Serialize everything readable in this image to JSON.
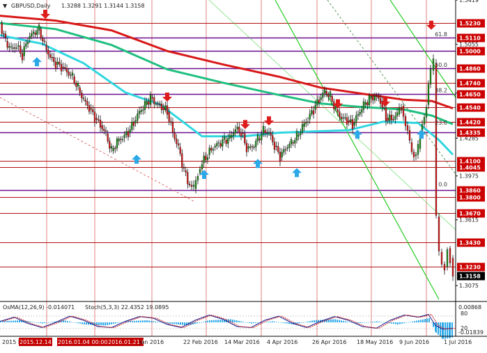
{
  "header": {
    "symbol_text": "GBPUSD,Daily",
    "ohlc_text": "1.3288 1.3291 1.3144 1.3158"
  },
  "osc": {
    "osma_text": "OsMA(12,26,9) -0.014071",
    "stoch_text": "Stoch(5,3,3) 22.4352 19.0895",
    "max_label": "0.00868",
    "min_label": "-0.01839",
    "level_80": "80",
    "level_20": "20"
  },
  "xaxis": {
    "ticks": [
      "2015 Nov",
      "2015.12.14",
      "2016.01.04 00:00",
      "2016.01.21 00:00",
      "Jan 2016",
      "22 Feb 2016",
      "14 Mar 2016",
      "4 Apr 2016",
      "26 Apr 2016",
      "18 May 2016",
      "9 Jun 2016",
      "1 Jul 2016"
    ],
    "highlight_from": 1,
    "highlight_to": 3
  },
  "colors": {
    "bull_candle": "#1a8a1a",
    "bear_candle": "#d01818",
    "ema200": "#d81818",
    "ema144": "#1fbf7f",
    "ema50": "#2fd6e0",
    "level_line": "#b01010",
    "level_line_purple": "#6a0f8e",
    "level_label_bg": "#cc0000",
    "arrow_up": "#2aa8e8",
    "arrow_down": "#dd1c1c",
    "channel": "#22cc22",
    "osma": "#2aa8e8",
    "stoch_main": "#1a1a8a",
    "stoch_signal": "#cc2222",
    "current_price_bg": "#000000"
  },
  "chart_data": {
    "type": "candlestick",
    "title": "GBPUSD,Daily",
    "ylim": [
      1.2962,
      1.5419
    ],
    "yticks": [
      1.5419,
      1.5055,
      1.4655,
      1.4285,
      1.3975,
      1.3615,
      1.3075
    ],
    "price_levels": [
      {
        "value": 1.523,
        "label": "1.5230"
      },
      {
        "value": 1.511,
        "label": "1.5110"
      },
      {
        "value": 1.5,
        "label": "1.5000"
      },
      {
        "value": 1.486,
        "label": "1.4860"
      },
      {
        "value": 1.474,
        "label": "1.4740"
      },
      {
        "value": 1.465,
        "label": "1.4650"
      },
      {
        "value": 1.454,
        "label": "1.4540"
      },
      {
        "value": 1.442,
        "label": "1.4420"
      },
      {
        "value": 1.4335,
        "label": "1.4335"
      },
      {
        "value": 1.41,
        "label": "1.4100"
      },
      {
        "value": 1.4045,
        "label": "1.4045"
      },
      {
        "value": 1.386,
        "label": "1.3860"
      },
      {
        "value": 1.38,
        "label": "1.3800"
      },
      {
        "value": 1.367,
        "label": "1.3670"
      },
      {
        "value": 1.343,
        "label": "1.3430"
      },
      {
        "value": 1.323,
        "label": "1.3230"
      }
    ],
    "current_price": "1.3158",
    "fibo_labels": [
      {
        "text": "61.8",
        "value": 1.511
      },
      {
        "text": "50.0",
        "value": 1.486
      },
      {
        "text": "38.2",
        "value": 1.465
      },
      {
        "text": "23.6",
        "value": 1.4385
      },
      {
        "text": "0.0",
        "value": 1.388
      }
    ],
    "close_path": [
      [
        0,
        1.523
      ],
      [
        8,
        1.508
      ],
      [
        16,
        1.502
      ],
      [
        24,
        1.504
      ],
      [
        32,
        1.496
      ],
      [
        40,
        1.51
      ],
      [
        48,
        1.515
      ],
      [
        56,
        1.518
      ],
      [
        64,
        1.505
      ],
      [
        72,
        1.495
      ],
      [
        80,
        1.489
      ],
      [
        88,
        1.487
      ],
      [
        96,
        1.483
      ],
      [
        104,
        1.479
      ],
      [
        112,
        1.47
      ],
      [
        120,
        1.46
      ],
      [
        128,
        1.453
      ],
      [
        136,
        1.445
      ],
      [
        144,
        1.439
      ],
      [
        152,
        1.432
      ],
      [
        160,
        1.418
      ],
      [
        168,
        1.426
      ],
      [
        176,
        1.429
      ],
      [
        184,
        1.433
      ],
      [
        192,
        1.441
      ],
      [
        200,
        1.45
      ],
      [
        208,
        1.456
      ],
      [
        216,
        1.462
      ],
      [
        224,
        1.457
      ],
      [
        232,
        1.454
      ],
      [
        240,
        1.45
      ],
      [
        248,
        1.433
      ],
      [
        256,
        1.421
      ],
      [
        264,
        1.402
      ],
      [
        272,
        1.39
      ],
      [
        278,
        1.387
      ],
      [
        284,
        1.4
      ],
      [
        290,
        1.408
      ],
      [
        298,
        1.415
      ],
      [
        306,
        1.421
      ],
      [
        314,
        1.424
      ],
      [
        322,
        1.427
      ],
      [
        330,
        1.429
      ],
      [
        338,
        1.436
      ],
      [
        346,
        1.433
      ],
      [
        354,
        1.42
      ],
      [
        362,
        1.421
      ],
      [
        370,
        1.428
      ],
      [
        378,
        1.435
      ],
      [
        386,
        1.433
      ],
      [
        394,
        1.422
      ],
      [
        402,
        1.413
      ],
      [
        410,
        1.42
      ],
      [
        418,
        1.425
      ],
      [
        426,
        1.43
      ],
      [
        434,
        1.438
      ],
      [
        442,
        1.444
      ],
      [
        450,
        1.452
      ],
      [
        458,
        1.46
      ],
      [
        466,
        1.467
      ],
      [
        474,
        1.463
      ],
      [
        482,
        1.452
      ],
      [
        490,
        1.445
      ],
      [
        498,
        1.443
      ],
      [
        506,
        1.439
      ],
      [
        514,
        1.448
      ],
      [
        522,
        1.456
      ],
      [
        530,
        1.461
      ],
      [
        538,
        1.463
      ],
      [
        546,
        1.459
      ],
      [
        554,
        1.445
      ],
      [
        562,
        1.444
      ],
      [
        570,
        1.448
      ],
      [
        576,
        1.455
      ],
      [
        582,
        1.439
      ],
      [
        588,
        1.425
      ],
      [
        594,
        1.414
      ],
      [
        600,
        1.42
      ],
      [
        606,
        1.44
      ],
      [
        612,
        1.456
      ],
      [
        618,
        1.484
      ],
      [
        622,
        1.49
      ],
      [
        626,
        1.364
      ],
      [
        630,
        1.335
      ],
      [
        634,
        1.325
      ],
      [
        638,
        1.323
      ],
      [
        642,
        1.338
      ],
      [
        646,
        1.33
      ],
      [
        650,
        1.3158
      ]
    ],
    "ema200": [
      [
        0,
        1.529
      ],
      [
        80,
        1.525
      ],
      [
        160,
        1.517
      ],
      [
        240,
        1.5
      ],
      [
        320,
        1.489
      ],
      [
        400,
        1.479
      ],
      [
        460,
        1.47
      ],
      [
        520,
        1.465
      ],
      [
        580,
        1.46
      ],
      [
        620,
        1.459
      ],
      [
        650,
        1.453
      ]
    ],
    "ema144": [
      [
        0,
        1.523
      ],
      [
        80,
        1.518
      ],
      [
        160,
        1.505
      ],
      [
        240,
        1.485
      ],
      [
        320,
        1.474
      ],
      [
        400,
        1.464
      ],
      [
        460,
        1.457
      ],
      [
        520,
        1.454
      ],
      [
        580,
        1.452
      ],
      [
        620,
        1.447
      ],
      [
        650,
        1.44
      ]
    ],
    "ema50": [
      [
        0,
        1.513
      ],
      [
        60,
        1.506
      ],
      [
        120,
        1.49
      ],
      [
        180,
        1.466
      ],
      [
        230,
        1.456
      ],
      [
        290,
        1.43
      ],
      [
        350,
        1.43
      ],
      [
        400,
        1.433
      ],
      [
        450,
        1.434
      ],
      [
        500,
        1.435
      ],
      [
        550,
        1.442
      ],
      [
        600,
        1.441
      ],
      [
        630,
        1.427
      ],
      [
        650,
        1.415
      ]
    ],
    "arrows_up": [
      [
        53,
        1.495
      ],
      [
        196,
        1.415
      ],
      [
        293,
        1.4025
      ],
      [
        370,
        1.4115
      ],
      [
        426,
        1.404
      ],
      [
        513,
        1.4355
      ],
      [
        605,
        1.4355
      ]
    ],
    "arrows_down": [
      [
        65,
        1.5265
      ],
      [
        240,
        1.4585
      ],
      [
        352,
        1.436
      ],
      [
        386,
        1.439
      ],
      [
        485,
        1.453
      ],
      [
        553,
        1.4545
      ],
      [
        619,
        1.5175
      ]
    ],
    "stoch": [
      [
        0,
        55
      ],
      [
        20,
        75
      ],
      [
        40,
        45
      ],
      [
        60,
        25
      ],
      [
        80,
        50
      ],
      [
        100,
        80
      ],
      [
        120,
        60
      ],
      [
        140,
        30
      ],
      [
        160,
        25
      ],
      [
        180,
        55
      ],
      [
        200,
        78
      ],
      [
        220,
        70
      ],
      [
        240,
        40
      ],
      [
        260,
        25
      ],
      [
        280,
        60
      ],
      [
        300,
        85
      ],
      [
        320,
        65
      ],
      [
        340,
        30
      ],
      [
        360,
        25
      ],
      [
        380,
        60
      ],
      [
        400,
        80
      ],
      [
        420,
        45
      ],
      [
        440,
        25
      ],
      [
        460,
        55
      ],
      [
        480,
        78
      ],
      [
        500,
        60
      ],
      [
        520,
        30
      ],
      [
        540,
        22
      ],
      [
        560,
        60
      ],
      [
        580,
        85
      ],
      [
        600,
        75
      ],
      [
        615,
        88
      ],
      [
        625,
        35
      ],
      [
        635,
        18
      ],
      [
        645,
        20
      ],
      [
        650,
        22
      ]
    ],
    "osma": [
      [
        0,
        0.001
      ],
      [
        30,
        0.002
      ],
      [
        60,
        -0.001
      ],
      [
        90,
        0.002
      ],
      [
        120,
        -0.002
      ],
      [
        150,
        -0.003
      ],
      [
        180,
        0.001
      ],
      [
        210,
        0.002
      ],
      [
        240,
        -0.001
      ],
      [
        270,
        -0.003
      ],
      [
        300,
        0.002
      ],
      [
        330,
        0.003
      ],
      [
        360,
        -0.001
      ],
      [
        390,
        0.001
      ],
      [
        420,
        -0.002
      ],
      [
        450,
        0.002
      ],
      [
        480,
        0.003
      ],
      [
        510,
        -0.001
      ],
      [
        540,
        0.001
      ],
      [
        570,
        -0.002
      ],
      [
        600,
        0.002
      ],
      [
        615,
        0.004
      ],
      [
        625,
        -0.01
      ],
      [
        635,
        -0.016
      ],
      [
        645,
        -0.015
      ],
      [
        650,
        -0.014
      ]
    ]
  }
}
